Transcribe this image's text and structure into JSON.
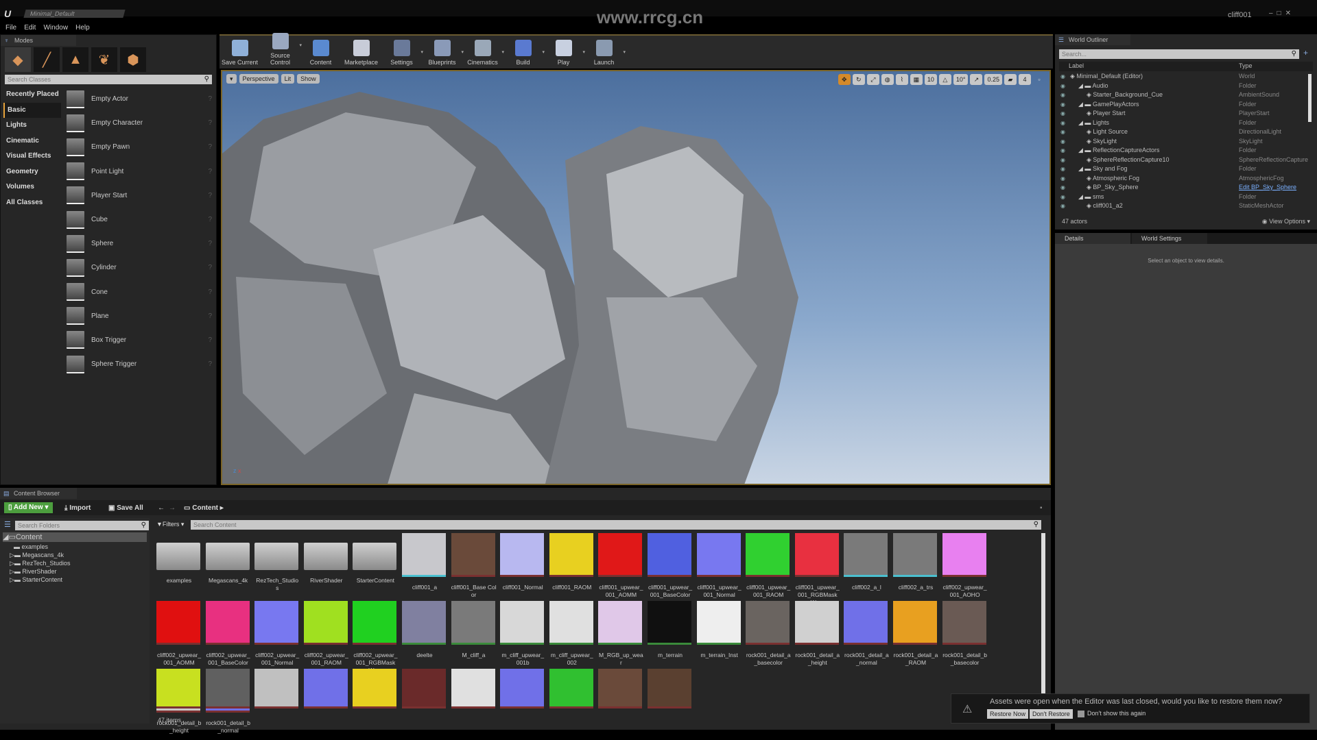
{
  "window": {
    "title_tab": "Minimal_Default",
    "watermark": "www.rrcg.cn",
    "project": "cliff001",
    "logo": "U"
  },
  "menu": [
    "File",
    "Edit",
    "Window",
    "Help"
  ],
  "modes": {
    "tab": "Modes",
    "mode_icons": [
      "place-icon",
      "paint-icon",
      "landscape-icon",
      "foliage-icon",
      "geometry-icon"
    ],
    "search_placeholder": "Search Classes",
    "categories": [
      "Recently Placed",
      "Basic",
      "Lights",
      "Cinematic",
      "Visual Effects",
      "Geometry",
      "Volumes",
      "All Classes"
    ],
    "selected_category": "Basic",
    "items": [
      "Empty Actor",
      "Empty Character",
      "Empty Pawn",
      "Point Light",
      "Player Start",
      "Cube",
      "Sphere",
      "Cylinder",
      "Cone",
      "Plane",
      "Box Trigger",
      "Sphere Trigger"
    ]
  },
  "toolbar": [
    {
      "label": "Save Current",
      "color": "#8fb0d8",
      "dropdown": false
    },
    {
      "label": "Source Control",
      "color": "#9aa8c0",
      "dropdown": true
    },
    {
      "label": "Content",
      "color": "#5a8ad0",
      "dropdown": false
    },
    {
      "label": "Marketplace",
      "color": "#c8ccd8",
      "dropdown": false
    },
    {
      "label": "Settings",
      "color": "#6a7a9a",
      "dropdown": true
    },
    {
      "label": "Blueprints",
      "color": "#8a9ab8",
      "dropdown": true
    },
    {
      "label": "Cinematics",
      "color": "#9aa8b8",
      "dropdown": true
    },
    {
      "label": "Build",
      "color": "#5a7ad0",
      "dropdown": true
    },
    {
      "label": "Play",
      "color": "#c8d0e0",
      "dropdown": true
    },
    {
      "label": "Launch",
      "color": "#8a9ab0",
      "dropdown": true
    }
  ],
  "viewport": {
    "buttons": [
      "Perspective",
      "Lit",
      "Show"
    ],
    "right_controls": [
      "translate",
      "rotate",
      "scale",
      "world",
      "surface-snap",
      "grid",
      "10",
      "angle",
      "10°",
      "scale-snap",
      "0.25",
      "camera-speed",
      "4"
    ],
    "axis_labels": {
      "z": "z",
      "x": "x"
    }
  },
  "outliner": {
    "tab": "World Outliner",
    "search_placeholder": "Search...",
    "col_label": "Label",
    "col_type": "Type",
    "rows": [
      {
        "label": "Minimal_Default (Editor)",
        "type": "World",
        "indent": 0
      },
      {
        "label": "Audio",
        "type": "Folder",
        "indent": 1
      },
      {
        "label": "Starter_Background_Cue",
        "type": "AmbientSound",
        "indent": 2
      },
      {
        "label": "GamePlayActors",
        "type": "Folder",
        "indent": 1
      },
      {
        "label": "Player Start",
        "type": "PlayerStart",
        "indent": 2
      },
      {
        "label": "Lights",
        "type": "Folder",
        "indent": 1
      },
      {
        "label": "Light Source",
        "type": "DirectionalLight",
        "indent": 2
      },
      {
        "label": "SkyLight",
        "type": "SkyLight",
        "indent": 2
      },
      {
        "label": "ReflectionCaptureActors",
        "type": "Folder",
        "indent": 1
      },
      {
        "label": "SphereReflectionCapture10",
        "type": "SphereReflectionCapture",
        "indent": 2
      },
      {
        "label": "Sky and Fog",
        "type": "Folder",
        "indent": 1
      },
      {
        "label": "Atmospheric Fog",
        "type": "AtmosphericFog",
        "indent": 2
      },
      {
        "label": "BP_Sky_Sphere",
        "type": "Edit BP_Sky_Sphere",
        "indent": 2,
        "link": true
      },
      {
        "label": "sms",
        "type": "Folder",
        "indent": 1
      },
      {
        "label": "cliff001_a2",
        "type": "StaticMeshActor",
        "indent": 2
      }
    ],
    "count": "47 actors",
    "view_options": "View Options"
  },
  "details": {
    "tabs": [
      "Details",
      "World Settings"
    ],
    "message": "Select an object to view details."
  },
  "content_browser": {
    "tab": "Content Browser",
    "add_new": "Add New",
    "import": "Import",
    "save_all": "Save All",
    "path": "Content",
    "folder_search_placeholder": "Search Folders",
    "tree": [
      "Content",
      "examples",
      "Megascans_4k",
      "RezTech_Studios",
      "RiverShader",
      "StarterContent"
    ],
    "filters": "Filters",
    "search_placeholder": "Search Content",
    "assets": [
      {
        "name": "examples",
        "kind": "folder"
      },
      {
        "name": "Megascans_4k",
        "kind": "folder"
      },
      {
        "name": "RezTech_Studios",
        "kind": "folder"
      },
      {
        "name": "RiverShader",
        "kind": "folder"
      },
      {
        "name": "StarterContent",
        "kind": "folder"
      },
      {
        "name": "cliff001_a",
        "color": "#c8c8cc",
        "bar": "#4ac0d0"
      },
      {
        "name": "cliff001_Base Color",
        "color": "#6a4a3a"
      },
      {
        "name": "cliff001_Normal",
        "color": "#b8b8f0"
      },
      {
        "name": "cliff001_RAOM",
        "color": "#e8d020"
      },
      {
        "name": "cliff001_upwear_001_AOMM",
        "color": "#e01818"
      },
      {
        "name": "cliff001_upwear_001_BaseColor",
        "color": "#5060e0"
      },
      {
        "name": "cliff001_upwear_001_Normal",
        "color": "#7878f0"
      },
      {
        "name": "cliff001_upwear_001_RAOM",
        "color": "#30d030"
      },
      {
        "name": "cliff001_upwear_001_RGBMask Wear",
        "color": "#e83040"
      },
      {
        "name": "cliff002_a_l",
        "color": "#7a7a7a",
        "bar": "#4ac0d0"
      },
      {
        "name": "cliff002_a_trs",
        "color": "#7a7a7a",
        "bar": "#4ac0d0"
      },
      {
        "name": "cliff002_upwear_001_AOHO",
        "color": "#e880f0"
      },
      {
        "name": "cliff002_upwear_001_AOMM",
        "color": "#e01010"
      },
      {
        "name": "cliff002_upwear_001_BaseColor",
        "color": "#e83080"
      },
      {
        "name": "cliff002_upwear_001_Normal",
        "color": "#7878f0"
      },
      {
        "name": "cliff002_upwear_001_RAOM",
        "color": "#a0e020"
      },
      {
        "name": "cliff002_upwear_001_RGBMask Wear",
        "color": "#20d020"
      },
      {
        "name": "deelte",
        "color": "#8080a0",
        "bar": "#3a8a3a"
      },
      {
        "name": "M_cliff_a",
        "color": "#7a7a7a",
        "bar": "#3a8a3a"
      },
      {
        "name": "m_cliff_upwear_001b",
        "color": "#d8d8d8",
        "bar": "#3a8a3a"
      },
      {
        "name": "m_cliff_upwear_002",
        "color": "#e0e0e0",
        "bar": "#3a8a3a"
      },
      {
        "name": "M_RGB_up_wear",
        "color": "#e0c8e8",
        "bar": "#3a8a3a"
      },
      {
        "name": "m_terrain",
        "color": "#101010",
        "bar": "#3a8a3a"
      },
      {
        "name": "m_terrain_Inst",
        "color": "#eeeeee",
        "bar": "#3a8a3a"
      },
      {
        "name": "rock001_detail_a_basecolor",
        "color": "#6a6460"
      },
      {
        "name": "rock001_detail_a_height",
        "color": "#d0d0d0"
      },
      {
        "name": "rock001_detail_a_normal",
        "color": "#7070e8"
      },
      {
        "name": "rock001_detail_a_RAOM",
        "color": "#e8a020"
      },
      {
        "name": "rock001_detail_b_basecolor",
        "color": "#6a5a54"
      },
      {
        "name": "rock001_detail_b_height",
        "color": "#c8c8c8"
      },
      {
        "name": "rock001_detail_b_normal",
        "color": "#7070e8"
      }
    ],
    "row3_thumbs": [
      "#c8e020",
      "#606060",
      "#c0c0c0",
      "#7070e8",
      "#e8d020",
      "#6a2a2a",
      "#e0e0e0",
      "#7070e8",
      "#30c030",
      "#6a4a3a",
      "#5a4030"
    ],
    "items_count": "47 items"
  },
  "notification": {
    "message": "Assets were open when the Editor was last closed, would you like to restore them now?",
    "restore": "Restore Now",
    "dont_restore": "Don't Restore",
    "dont_show": "Don't show this again"
  }
}
